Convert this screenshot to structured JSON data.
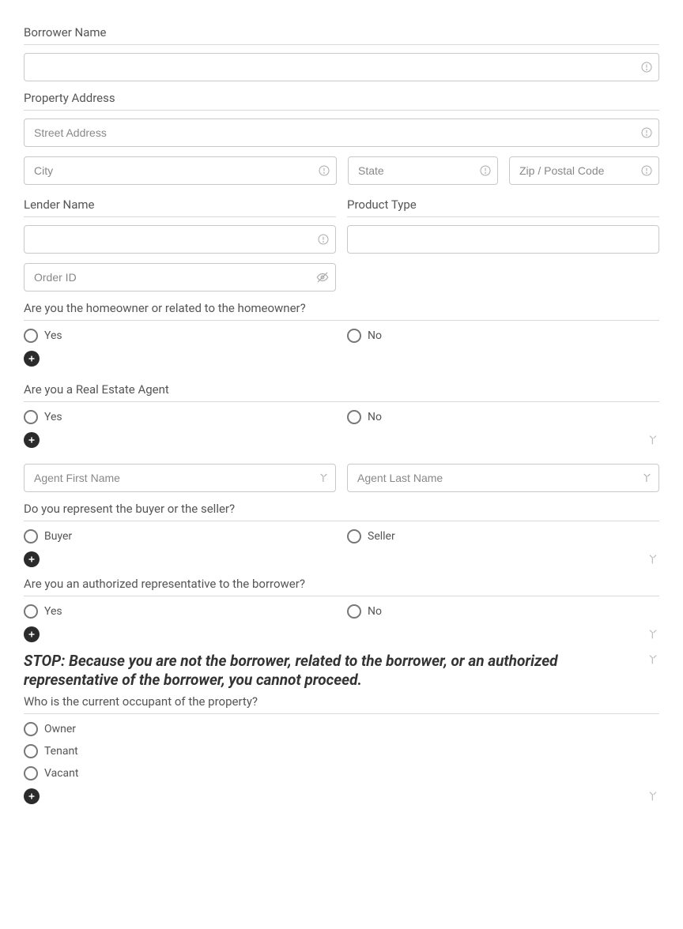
{
  "labels": {
    "borrower_name": "Borrower Name",
    "property_address": "Property Address",
    "lender_name": "Lender Name",
    "product_type": "Product Type"
  },
  "placeholders": {
    "street": "Street Address",
    "city": "City",
    "state": "State",
    "zip": "Zip / Postal Code",
    "order_id": "Order ID",
    "agent_first": "Agent First Name",
    "agent_last": "Agent Last Name"
  },
  "questions": {
    "homeowner": "Are you the homeowner or related to the homeowner?",
    "real_estate_agent": "Are you a Real Estate Agent",
    "buyer_seller": "Do you represent the buyer or the seller?",
    "authorized_rep": "Are you an authorized representative to the borrower?",
    "occupant": "Who is the current occupant of the property?"
  },
  "options": {
    "yes": "Yes",
    "no": "No",
    "buyer": "Buyer",
    "seller": "Seller",
    "owner": "Owner",
    "tenant": "Tenant",
    "vacant": "Vacant"
  },
  "stop_message": "STOP: Because you are not the borrower, related to the borrower, or an authorized representative of the borrower, you cannot proceed."
}
